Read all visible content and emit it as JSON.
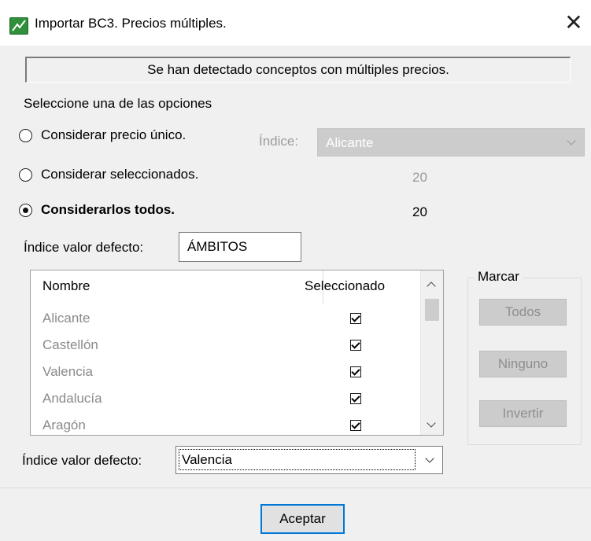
{
  "window": {
    "title": "Importar BC3. Precios múltiples.",
    "close_glyph": "✕"
  },
  "message": "Se han detectado conceptos con múltiples precios.",
  "options_label": "Seleccione una de las opciones",
  "options": {
    "unique": {
      "label": "Considerar precio único.",
      "checked": false
    },
    "selected": {
      "label": "Considerar seleccionados.",
      "checked": false,
      "count": "20"
    },
    "all": {
      "label": "Considerarlos todos.",
      "checked": true,
      "count": "20"
    }
  },
  "index_combo": {
    "label": "Índice:",
    "value": "Alicante"
  },
  "default_index": {
    "label": "Índice valor defecto:",
    "value": "ÁMBITOS"
  },
  "table": {
    "columns": [
      "Nombre",
      "Seleccionado"
    ],
    "rows": [
      {
        "name": "Alicante",
        "selected": true
      },
      {
        "name": "Castellón",
        "selected": true
      },
      {
        "name": "Valencia",
        "selected": true
      },
      {
        "name": "Andalucía",
        "selected": true
      },
      {
        "name": "Aragón",
        "selected": true
      }
    ]
  },
  "mark_group": {
    "title": "Marcar",
    "all": "Todos",
    "none": "Ninguno",
    "invert": "Invertir"
  },
  "default_index_combo": {
    "label": "Índice valor defecto:",
    "value": "Valencia"
  },
  "accept_label": "Aceptar",
  "colors": {
    "accent": "#0078d7",
    "icon_green": "#2f8f3a"
  }
}
